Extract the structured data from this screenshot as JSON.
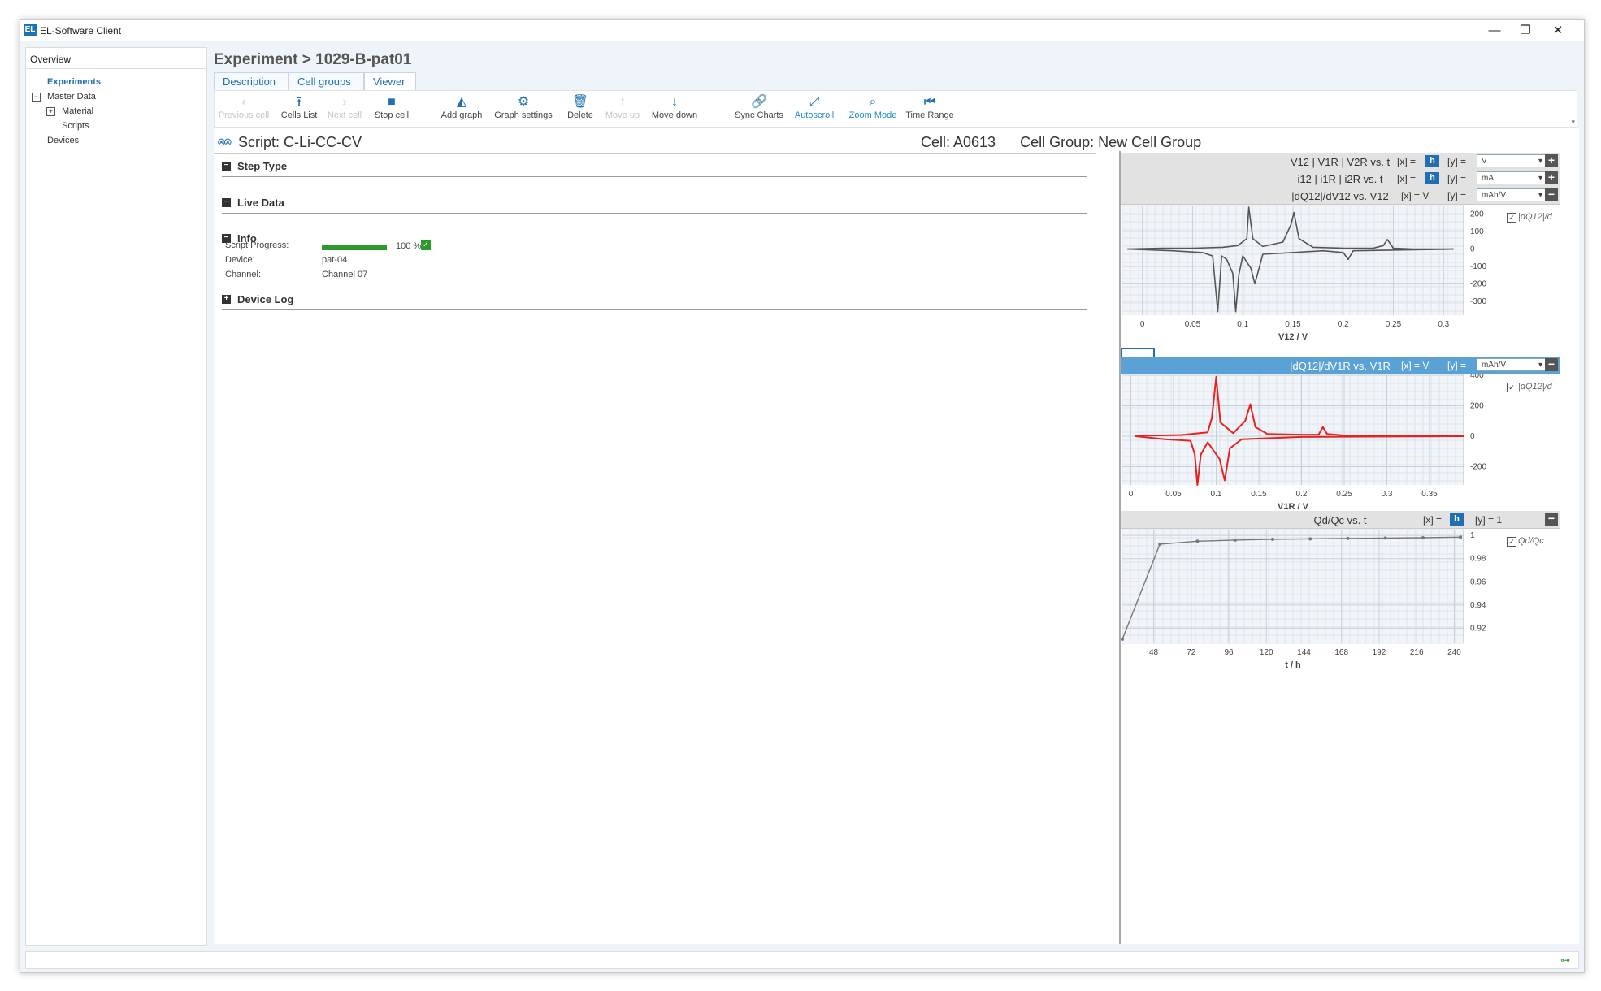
{
  "window": {
    "title": "EL-Software Client",
    "minimize": "—",
    "maximize": "❐",
    "close": "✕"
  },
  "sidebar": {
    "overview": "Overview",
    "items": [
      {
        "label": "Experiments"
      },
      {
        "label": "Master Data"
      },
      {
        "label": "Material"
      },
      {
        "label": "Scripts"
      },
      {
        "label": "Devices"
      }
    ]
  },
  "header": {
    "title": "Experiment > 1029-B-pat01"
  },
  "tabs": [
    {
      "label": "Description"
    },
    {
      "label": "Cell groups"
    },
    {
      "label": "Viewer"
    }
  ],
  "toolbar": {
    "previous_cell": "Previous cell",
    "cells_list": "Cells List",
    "next_cell": "Next cell",
    "stop_cell": "Stop cell",
    "add_graph": "Add graph",
    "graph_settings": "Graph settings",
    "delete": "Delete",
    "move_up": "Move up",
    "move_down": "Move down",
    "sync_charts": "Sync Charts",
    "autoscroll": "Autoscroll",
    "zoom_mode": "Zoom Mode",
    "time_range": "Time Range"
  },
  "script": {
    "title": "Script: C-Li-CC-CV",
    "cell": "Cell:  A0613",
    "cell_group": "Cell Group:  New Cell Group"
  },
  "sections": {
    "step_type": "Step Type",
    "live_data": "Live Data",
    "info": "Info",
    "device_log": "Device Log"
  },
  "info": {
    "progress_label": "Script Progress:",
    "progress_percent": 100,
    "progress_text": "100 %",
    "device_label": "Device:",
    "device_value": "pat-04",
    "channel_label": "Channel:",
    "channel_value": "Channel 07"
  },
  "charts": {
    "c1": {
      "title": "V12 | V1R | V2R vs. t",
      "x": "[x]  =",
      "xbtn": "h",
      "y": "[y]  =",
      "ysel": "V",
      "btn": "+"
    },
    "c2": {
      "title": "i12 | i1R | i2R vs. t",
      "x": "[x]  =",
      "xbtn": "h",
      "y": "[y]  =",
      "ysel": "mA",
      "btn": "+"
    },
    "c3": {
      "title": "|dQ12|/dV12 vs. V12",
      "x": "[x]  =  V",
      "y": "[y]  =",
      "ysel": "mAh/V",
      "btn": "−",
      "legend": "|dQ12|/d",
      "xlabel": "V12 / V"
    },
    "c4": {
      "title": "|dQ12|/dV1R vs. V1R",
      "x": "[x]  =  V",
      "y": "[y]  =",
      "ysel": "mAh/V",
      "btn": "−",
      "legend": "|dQ12|/d",
      "xlabel": "V1R / V"
    },
    "c5": {
      "title": "Qd/Qc vs. t",
      "x": "[x]  =",
      "xbtn": "h",
      "y": "[y]  =  1",
      "btn": "−",
      "legend": "Qd/Qc",
      "xlabel": "t /  h"
    }
  },
  "chart_data": [
    {
      "type": "line",
      "title": "|dQ12|/dV12 vs. V12",
      "xlabel": "V12 / V",
      "xlim": [
        -0.02,
        0.32
      ],
      "ylim": [
        -380,
        250
      ],
      "x_ticks": [
        0,
        0.05,
        0.1,
        0.15,
        0.2,
        0.25,
        0.3
      ],
      "y_ticks": [
        200,
        100,
        0,
        -100,
        -200,
        -300
      ],
      "series": [
        {
          "name": "|dQ12|/d",
          "color": "#555555",
          "x": [
            -0.015,
            0.02,
            0.05,
            0.08,
            0.095,
            0.104,
            0.106,
            0.11,
            0.12,
            0.14,
            0.148,
            0.151,
            0.156,
            0.17,
            0.2,
            0.23,
            0.24,
            0.244,
            0.25,
            0.27,
            0.31
          ],
          "y": [
            0,
            5,
            5,
            10,
            20,
            60,
            240,
            60,
            15,
            40,
            140,
            210,
            60,
            10,
            5,
            5,
            20,
            55,
            5,
            0,
            0
          ]
        },
        {
          "name": "|dQ12|/d",
          "color": "#555555",
          "x": [
            -0.015,
            0.03,
            0.06,
            0.07,
            0.075,
            0.079,
            0.084,
            0.09,
            0.093,
            0.096,
            0.1,
            0.108,
            0.112,
            0.12,
            0.18,
            0.2,
            0.205,
            0.21,
            0.31
          ],
          "y": [
            0,
            -10,
            -20,
            -40,
            -360,
            -40,
            -60,
            -140,
            -360,
            -150,
            -40,
            -110,
            -200,
            -30,
            -10,
            -20,
            -60,
            -10,
            0
          ]
        }
      ]
    },
    {
      "type": "line",
      "title": "|dQ12|/dV1R vs. V1R",
      "xlabel": "V1R / V",
      "xlim": [
        -0.01,
        0.39
      ],
      "ylim": [
        -320,
        400
      ],
      "x_ticks": [
        0,
        0.05,
        0.1,
        0.15,
        0.2,
        0.25,
        0.3,
        0.35
      ],
      "y_ticks": [
        400,
        200,
        0,
        -200
      ],
      "series": [
        {
          "name": "|dQ12|/d",
          "color": "#e82020",
          "x": [
            0.005,
            0.03,
            0.06,
            0.09,
            0.095,
            0.1,
            0.105,
            0.12,
            0.134,
            0.14,
            0.146,
            0.16,
            0.2,
            0.22,
            0.225,
            0.23,
            0.25,
            0.39
          ],
          "y": [
            5,
            5,
            8,
            25,
            120,
            390,
            90,
            20,
            100,
            210,
            60,
            15,
            10,
            10,
            60,
            15,
            5,
            0
          ]
        },
        {
          "name": "|dQ12|/d",
          "color": "#e82020",
          "x": [
            0.005,
            0.04,
            0.07,
            0.075,
            0.078,
            0.082,
            0.09,
            0.104,
            0.11,
            0.116,
            0.13,
            0.2,
            0.39
          ],
          "y": [
            0,
            -20,
            -30,
            -120,
            -320,
            -120,
            -40,
            -150,
            -290,
            -80,
            -20,
            -5,
            0
          ]
        }
      ]
    },
    {
      "type": "line",
      "title": "Qd/Qc vs. t",
      "xlabel": "t /  h",
      "xlim": [
        28,
        246
      ],
      "ylim": [
        0.907,
        1.005
      ],
      "x_ticks": [
        48,
        72,
        96,
        120,
        144,
        168,
        192,
        216,
        240
      ],
      "y_ticks": [
        1,
        0.98,
        0.96,
        0.94,
        0.92
      ],
      "series": [
        {
          "name": "Qd/Qc",
          "color": "#777777",
          "x": [
            28,
            52,
            76,
            100,
            124,
            148,
            172,
            196,
            220,
            244
          ],
          "y": [
            0.9105,
            0.9925,
            0.995,
            0.996,
            0.9967,
            0.997,
            0.9974,
            0.9977,
            0.998,
            0.9985
          ]
        }
      ]
    }
  ]
}
